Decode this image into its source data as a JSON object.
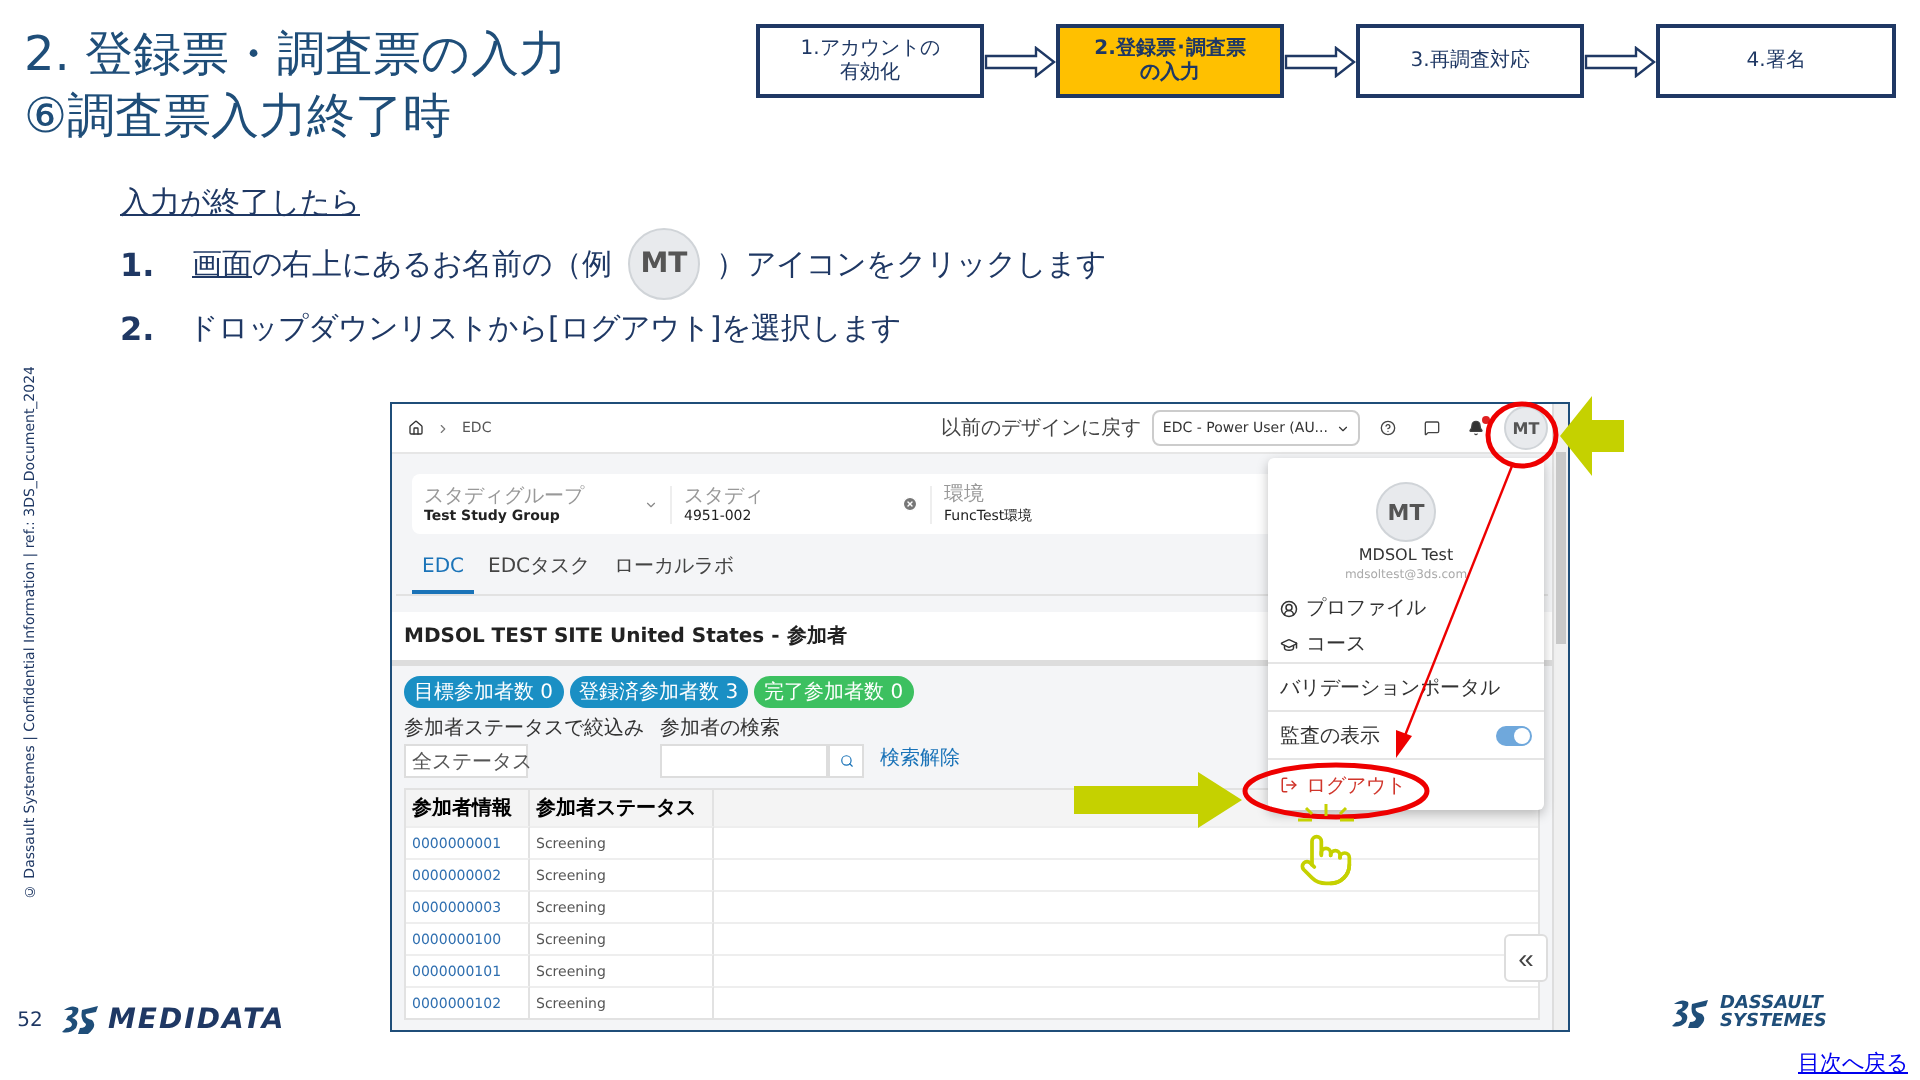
{
  "title": [
    "2. 登録票・調査票の入力",
    "⑥調査票入力終了時"
  ],
  "steps": [
    {
      "label": [
        "1.アカウントの",
        "有効化"
      ],
      "selected": false
    },
    {
      "label": [
        "2.登録票･調査票",
        "の入力"
      ],
      "selected": true
    },
    {
      "label": [
        "3.再調査対応"
      ],
      "selected": false
    },
    {
      "label": [
        "4.署名"
      ],
      "selected": false
    }
  ],
  "instructions": {
    "lead": "入力が終了したら",
    "items": [
      {
        "number": "1.",
        "segments": [
          {
            "kind": "link",
            "text": "画面"
          },
          {
            "kind": "text",
            "text": "の右上にあるお名前の（例"
          },
          {
            "kind": "avatar",
            "text": "MT"
          },
          {
            "kind": "text",
            "text": "）アイコンをクリックします"
          }
        ]
      },
      {
        "number": "2.",
        "segments": [
          {
            "kind": "text",
            "text": "ドロップダウンリストから[ログアウト]を選択します"
          }
        ]
      }
    ]
  },
  "app": {
    "breadcrumb": "EDC",
    "revert_link": "以前のデザインに戻す",
    "role_select": "EDC - Power User (AU...",
    "avatar": "MT",
    "filters": [
      {
        "label": "スタディグループ",
        "value": "Test Study Group"
      },
      {
        "label": "スタディ",
        "value": "4951-002"
      },
      {
        "label": "環境",
        "value": "FuncTest環境"
      }
    ],
    "tabs": [
      {
        "label": "EDC",
        "selected": true
      },
      {
        "label": "EDCタスク",
        "selected": false
      },
      {
        "label": "ローカルラボ",
        "selected": false
      }
    ],
    "site_title": "MDSOL TEST SITE United States - 参加者",
    "badges": [
      {
        "label": "目標参加者数 0",
        "color": "#1a8fc4"
      },
      {
        "label": "登録済参加者数 3",
        "color": "#1a8fc4"
      },
      {
        "label": "完了参加者数 0",
        "color": "#3cc060"
      }
    ],
    "status_filter": {
      "label": "参加者ステータスで絞込み",
      "value": "全ステータス"
    },
    "search": {
      "label": "参加者の検索",
      "clear_link": "検索解除"
    },
    "table": {
      "columns": [
        "参加者情報",
        "参加者ステータス"
      ],
      "rows": [
        [
          "0000000001",
          "Screening"
        ],
        [
          "0000000002",
          "Screening"
        ],
        [
          "0000000003",
          "Screening"
        ],
        [
          "0000000100",
          "Screening"
        ],
        [
          "0000000101",
          "Screening"
        ],
        [
          "0000000102",
          "Screening"
        ]
      ]
    },
    "collapse_button": "«",
    "user_menu": {
      "avatar": "MT",
      "name": "MDSOL Test",
      "email": "mdsoltest@3ds.com",
      "items": [
        {
          "kind": "profile",
          "label": "プロファイル"
        },
        {
          "kind": "course",
          "label": "コース"
        },
        {
          "kind": "link",
          "label": "バリデーションポータル"
        },
        {
          "kind": "toggle",
          "label": "監査の表示",
          "on": true
        },
        {
          "kind": "logout",
          "label": "ログアウト"
        }
      ]
    }
  },
  "footer": {
    "copyright": "© Dassault Systemes | Confidential Information | ref.: 3DS_Document_2024",
    "page_number": "52",
    "medidata_logo": "MEDIDATA",
    "dassault_logo": [
      "DASSAULT",
      "SYSTEMES"
    ],
    "back_link": "目次へ戻る"
  }
}
